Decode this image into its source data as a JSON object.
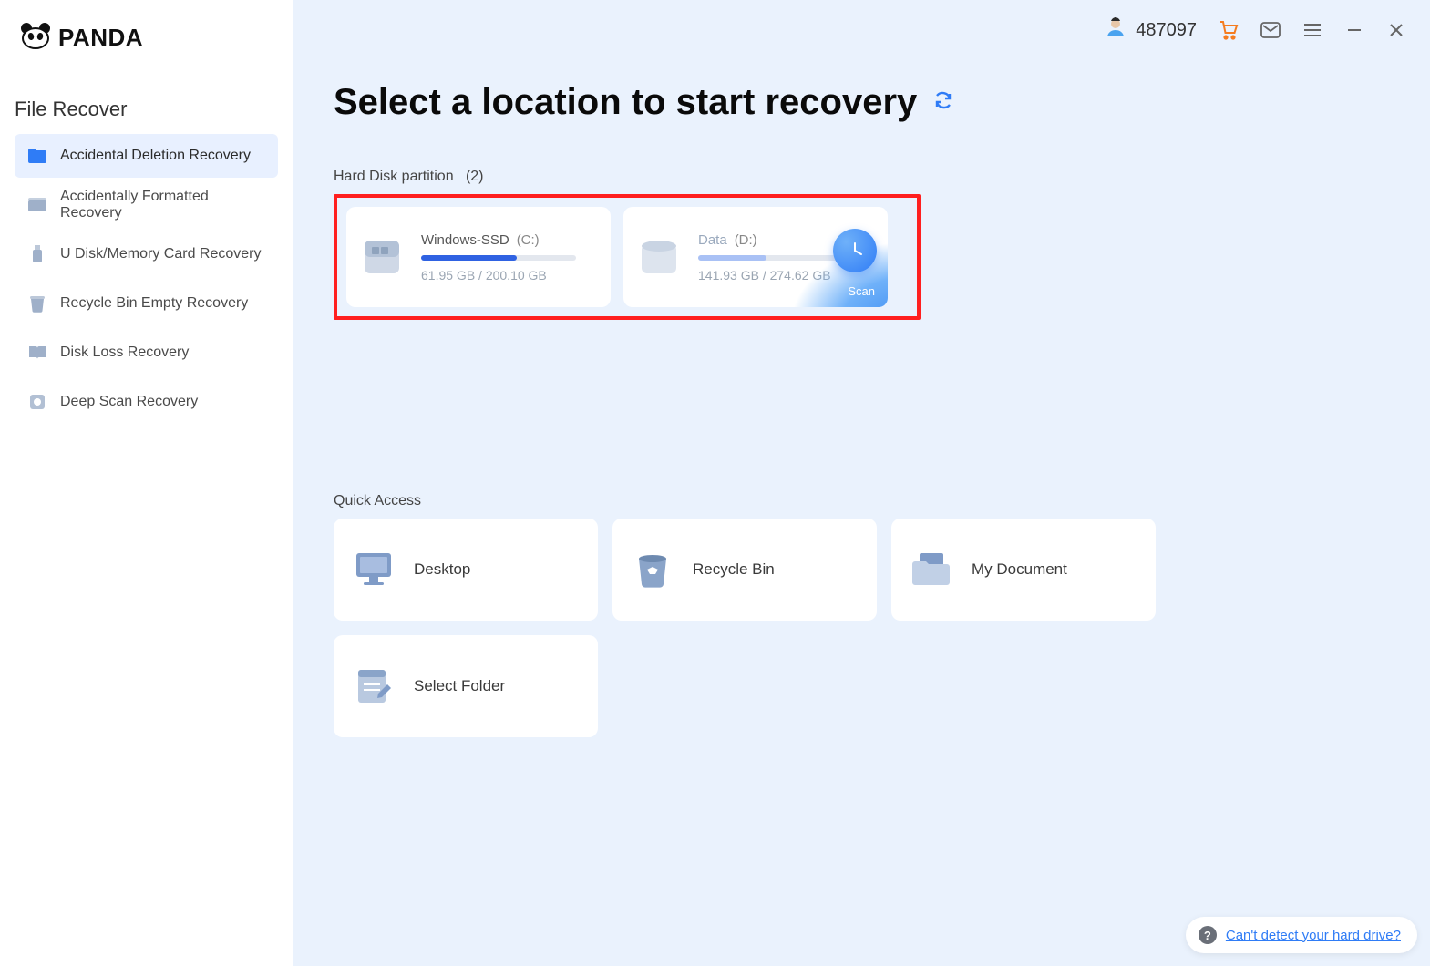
{
  "app": {
    "name": "PANDA"
  },
  "sidebar": {
    "section_title": "File Recover",
    "items": [
      {
        "label": "Accidental Deletion Recovery",
        "active": true
      },
      {
        "label": "Accidentally Formatted Recovery",
        "active": false
      },
      {
        "label": "U Disk/Memory Card Recovery",
        "active": false
      },
      {
        "label": "Recycle Bin Empty Recovery",
        "active": false
      },
      {
        "label": "Disk Loss Recovery",
        "active": false
      },
      {
        "label": "Deep Scan Recovery",
        "active": false
      }
    ]
  },
  "topbar": {
    "user_id": "487097"
  },
  "main": {
    "title": "Select a location to start recovery",
    "partition_section": {
      "label": "Hard Disk partition",
      "count": "(2)"
    },
    "partitions": [
      {
        "name": "Windows-SSD",
        "letter": "(C:)",
        "used": "61.95 GB",
        "total": "200.10 GB",
        "fill_pct": 62,
        "hovered": false
      },
      {
        "name": "Data",
        "letter": "(D:)",
        "used": "141.93 GB",
        "total": "274.62 GB",
        "fill_pct": 44,
        "hovered": true,
        "scan_label": "Scan"
      }
    ],
    "quick_access_label": "Quick Access",
    "quick_access": [
      {
        "label": "Desktop",
        "icon": "monitor"
      },
      {
        "label": "Recycle Bin",
        "icon": "bin"
      },
      {
        "label": "My Document",
        "icon": "folder"
      },
      {
        "label": "Select Folder",
        "icon": "note"
      }
    ],
    "help_link": "Can't detect your hard drive?"
  }
}
